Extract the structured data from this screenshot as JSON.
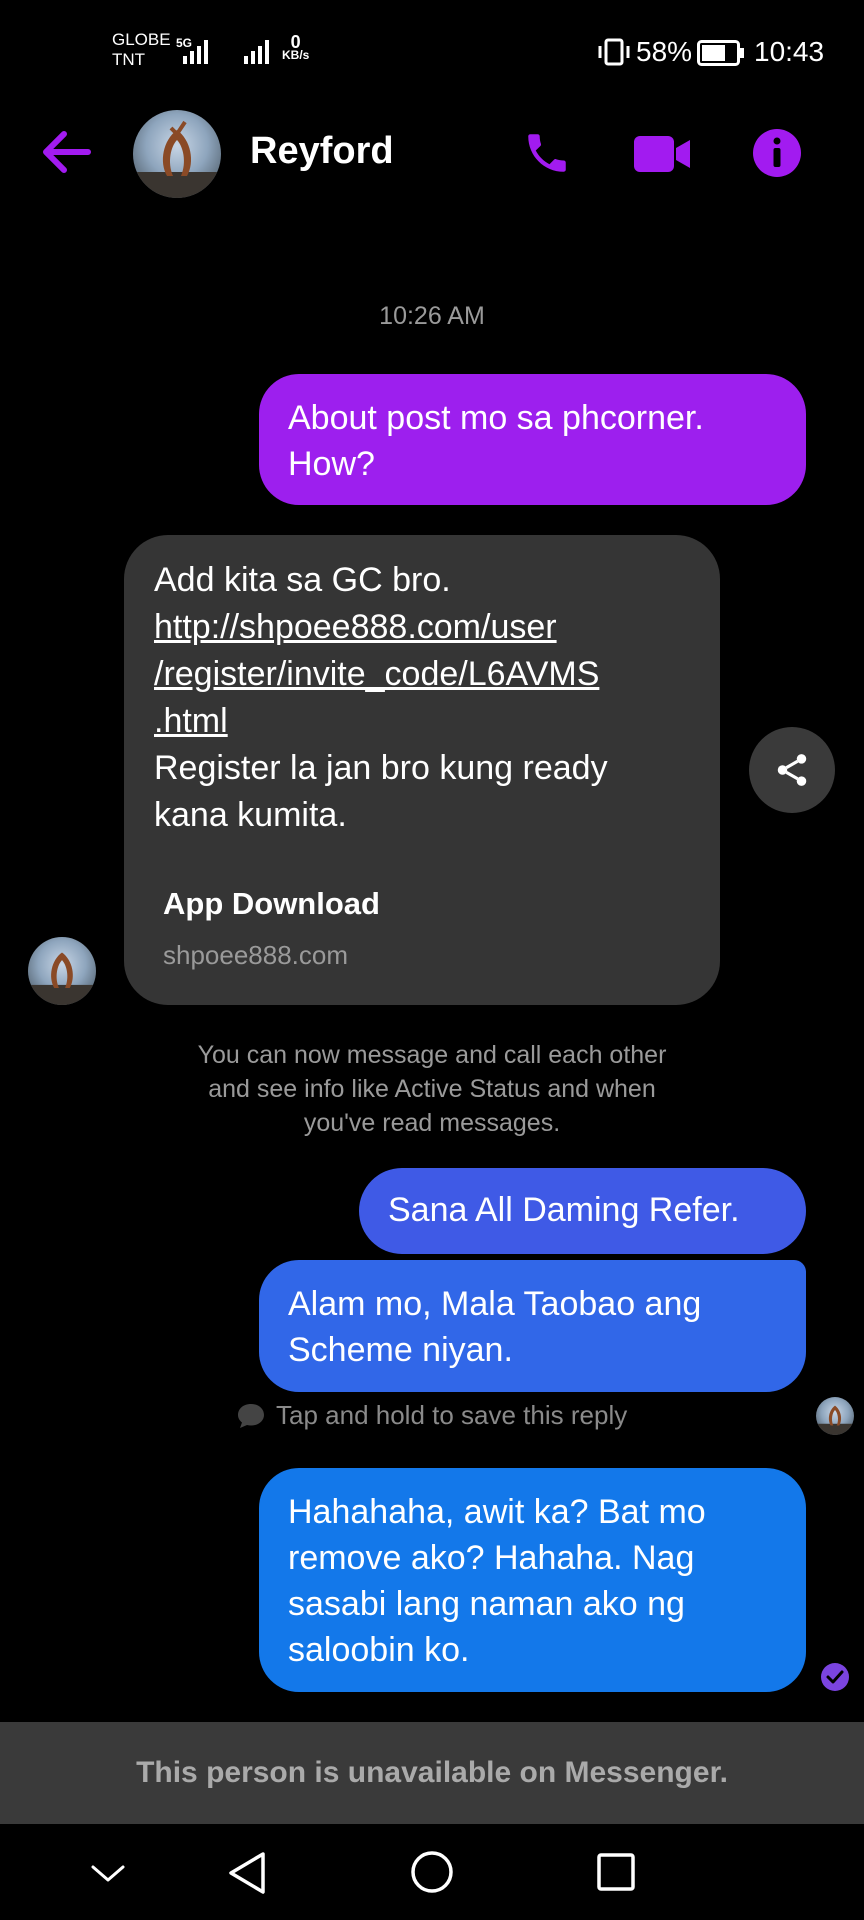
{
  "status_bar": {
    "carrier_line1": "GLOBE",
    "carrier_line2": "TNT",
    "network": "5G",
    "speed_value": "0",
    "speed_unit": "KB/s",
    "battery": "58%",
    "time": "10:43"
  },
  "header": {
    "name": "Reyford",
    "back_icon": "back-arrow-icon",
    "call_icon": "phone-icon",
    "video_icon": "video-camera-icon",
    "info_icon": "info-icon"
  },
  "conversation": {
    "timestamp": "10:26 AM",
    "msg1": [
      "About post mo sa phcorner.",
      "How?"
    ],
    "incoming": {
      "line1": "Add kita sa GC bro.",
      "link_lines": [
        "http://shpoee888.com/user",
        "/register/invite_code/L6AVMS",
        ".html"
      ],
      "line2": "Register la jan bro kung ready",
      "line3": "kana kumita.",
      "preview_title": "App Download",
      "preview_domain": "shpoee888.com"
    },
    "system_notice": [
      "You can now message and call each other",
      "and see info like Active Status and when",
      "you've read messages."
    ],
    "msg2": "Sana All Daming Refer.",
    "msg3": [
      "Alam mo, Mala Taobao ang",
      "Scheme niyan."
    ],
    "hint": "Tap and hold to save this reply",
    "msg4": [
      "Hahahaha, awit ka? Bat mo",
      "remove ako? Hahaha. Nag",
      "sasabi lang naman ako ng",
      "saloobin ko."
    ]
  },
  "footer": {
    "unavailable": "This person is unavailable on Messenger."
  },
  "colors": {
    "accent": "#a21bf0",
    "bubble_purple": "#9d1fee",
    "bubble_indigo": "#3f5ae6",
    "bubble_blue": "#1378ea",
    "incoming_bg": "#353535"
  }
}
